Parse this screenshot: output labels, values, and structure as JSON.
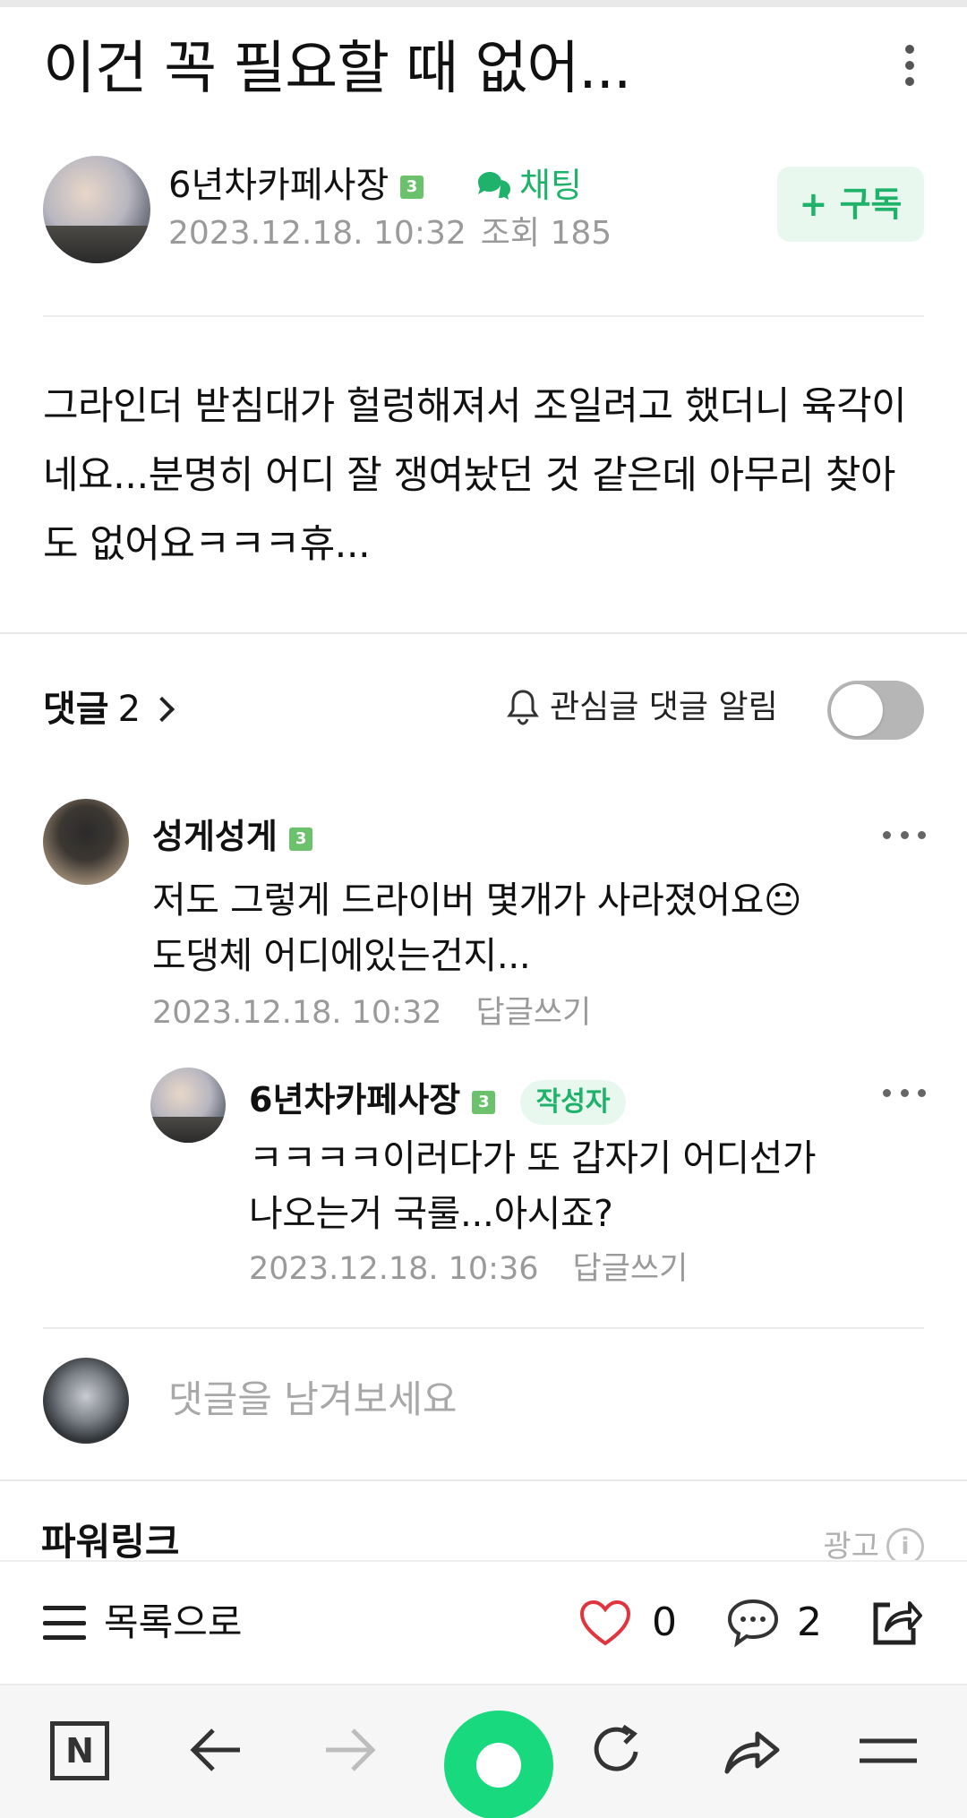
{
  "post": {
    "title": "이건 꼭 필요할 때 없어...",
    "author": "6년차카페사장",
    "author_level": "3",
    "chat_label": "채팅",
    "date": "2023.12.18. 10:32",
    "views": "조회 185",
    "subscribe_label": "+ 구독",
    "body": "그라인더 받침대가 헐렁해져서 조일려고 했더니 육각이네요...분명히 어디 잘 쟁여놨던 것 같은데 아무리 찾아도 없어요ㅋㅋㅋ휴..."
  },
  "comments_section": {
    "label": "댓글",
    "count": "2",
    "notify_label": "관심글 댓글 알림",
    "notify_on": false
  },
  "comments": [
    {
      "author": "성게성게",
      "level": "3",
      "text_line1": "저도 그렇게 드라이버 몇개가 사라졌어요😐",
      "text_line2": "도댕체 어디에있는건지...",
      "date": "2023.12.18. 10:32",
      "reply_label": "답글쓰기"
    },
    {
      "author": "6년차카페사장",
      "level": "3",
      "badge": "작성자",
      "text_line1": "ㅋㅋㅋㅋ이러다가 또 갑자기 어디선가",
      "text_line2": "나오는거 국룰...아시죠?",
      "date": "2023.12.18. 10:36",
      "reply_label": "답글쓰기"
    }
  ],
  "comment_input": {
    "placeholder": "댓글을 남겨보세요"
  },
  "ads": {
    "powerlink_label": "파워링크",
    "ad_label": "광고",
    "info_glyph": "i"
  },
  "article_bar": {
    "list_label": "목록으로",
    "likes": "0",
    "comments": "2"
  },
  "browser_bar": {
    "logo": "N"
  },
  "colors": {
    "accent": "#1fb26b",
    "level_badge": "#6cc26c",
    "like_heart": "#e0353f"
  }
}
